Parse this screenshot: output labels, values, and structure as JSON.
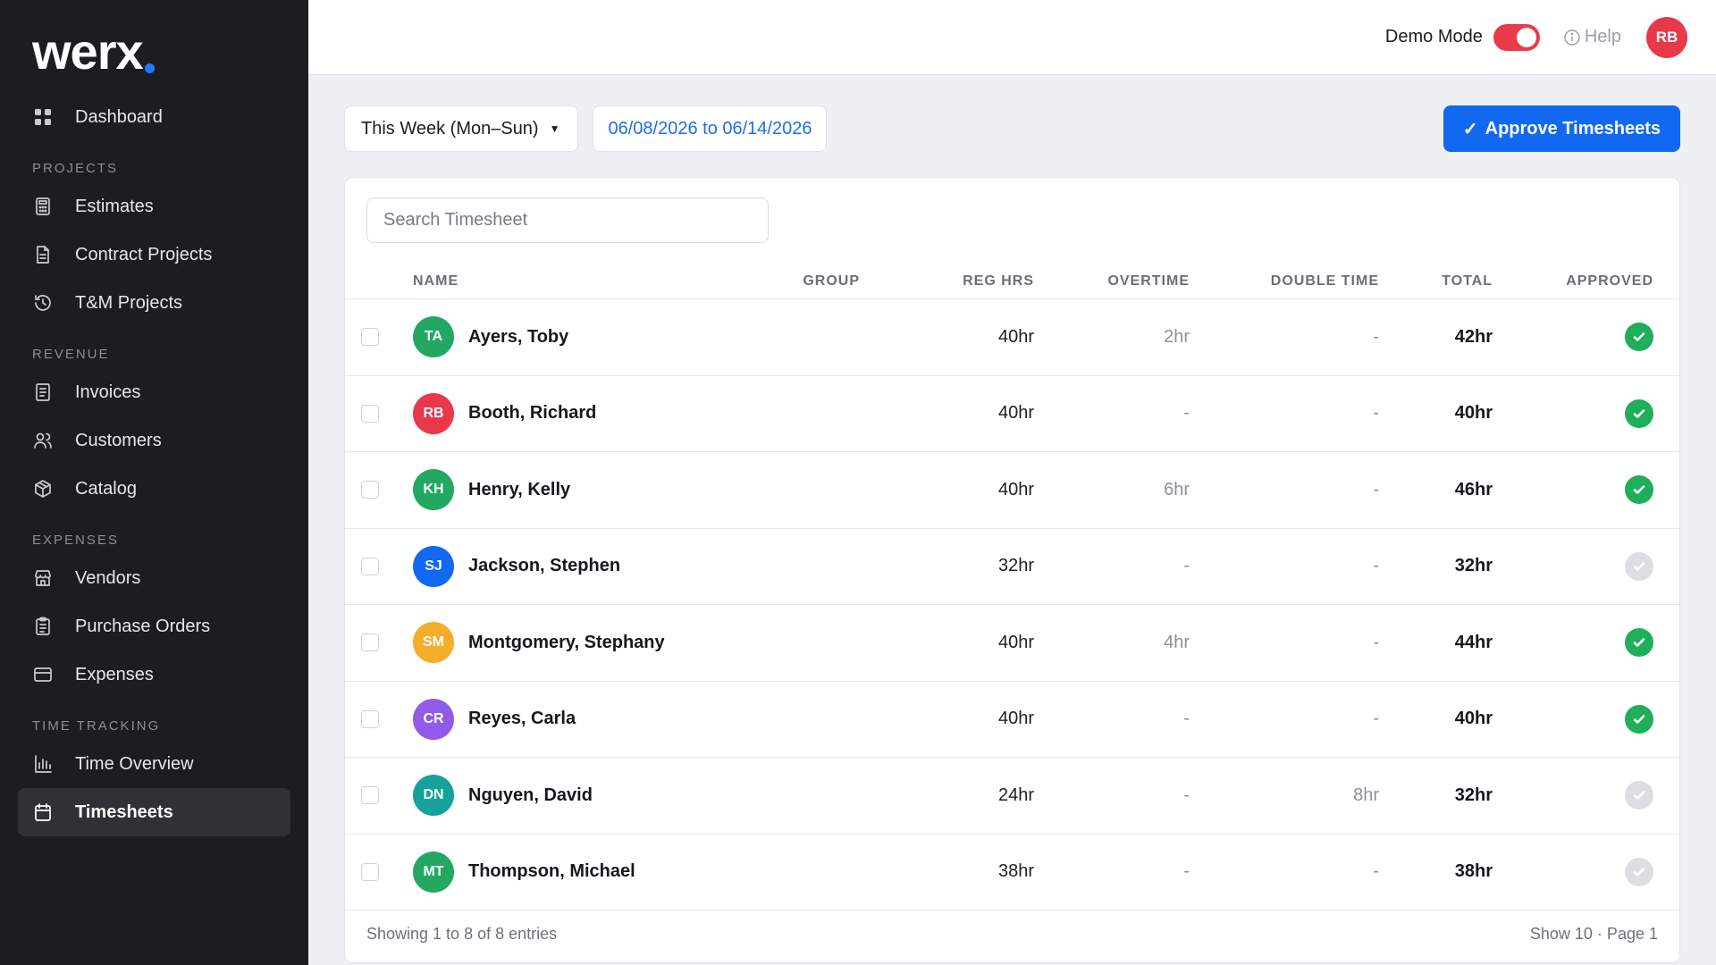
{
  "brand": {
    "name": "werx",
    "accent": "#1e7bff"
  },
  "sidebar": {
    "dashboard": {
      "label": "Dashboard",
      "icon": "dashboard-grid-icon"
    },
    "sections": [
      {
        "label": "PROJECTS",
        "items": [
          {
            "label": "Estimates",
            "icon": "calculator-icon"
          },
          {
            "label": "Contract Projects",
            "icon": "document-icon"
          },
          {
            "label": "T&M Projects",
            "icon": "history-icon"
          }
        ]
      },
      {
        "label": "REVENUE",
        "items": [
          {
            "label": "Invoices",
            "icon": "receipt-icon"
          },
          {
            "label": "Customers",
            "icon": "users-icon"
          },
          {
            "label": "Catalog",
            "icon": "box-icon"
          }
        ]
      },
      {
        "label": "EXPENSES",
        "items": [
          {
            "label": "Vendors",
            "icon": "store-icon"
          },
          {
            "label": "Purchase Orders",
            "icon": "clipboard-icon"
          },
          {
            "label": "Expenses",
            "icon": "credit-card-icon"
          }
        ]
      },
      {
        "label": "TIME TRACKING",
        "items": [
          {
            "label": "Time Overview",
            "icon": "bar-chart-icon"
          },
          {
            "label": "Timesheets",
            "icon": "calendar-icon",
            "active": true
          }
        ]
      }
    ]
  },
  "topbar": {
    "demo_mode_label": "Demo Mode",
    "demo_mode_on": true,
    "help_label": "Help",
    "user_initials": "RB",
    "user_color": "#e8384a"
  },
  "controls": {
    "week_select": "This Week (Mon–Sun)",
    "date_range": "06/08/2026 to 06/14/2026",
    "approve_label": "Approve Timesheets"
  },
  "search": {
    "placeholder": "Search Timesheet",
    "value": ""
  },
  "table": {
    "columns": {
      "name": "NAME",
      "group": "GROUP",
      "reg": "REG HRS",
      "overtime": "OVERTIME",
      "double": "DOUBLE TIME",
      "total": "TOTAL",
      "approved": "APPROVED"
    },
    "rows": [
      {
        "initials": "TA",
        "color": "#22a862",
        "name": "Ayers, Toby",
        "group": "",
        "reg": "40hr",
        "overtime": "2hr",
        "double": "-",
        "total": "42hr",
        "approved": true
      },
      {
        "initials": "RB",
        "color": "#e8384a",
        "name": "Booth, Richard",
        "group": "",
        "reg": "40hr",
        "overtime": "-",
        "double": "-",
        "total": "40hr",
        "approved": true
      },
      {
        "initials": "KH",
        "color": "#22a862",
        "name": "Henry, Kelly",
        "group": "",
        "reg": "40hr",
        "overtime": "6hr",
        "double": "-",
        "total": "46hr",
        "approved": true
      },
      {
        "initials": "SJ",
        "color": "#1169f2",
        "name": "Jackson, Stephen",
        "group": "",
        "reg": "32hr",
        "overtime": "-",
        "double": "-",
        "total": "32hr",
        "approved": false
      },
      {
        "initials": "SM",
        "color": "#f5ad2a",
        "name": "Montgomery, Stephany",
        "group": "",
        "reg": "40hr",
        "overtime": "4hr",
        "double": "-",
        "total": "44hr",
        "approved": true
      },
      {
        "initials": "CR",
        "color": "#8f5be8",
        "name": "Reyes, Carla",
        "group": "",
        "reg": "40hr",
        "overtime": "-",
        "double": "-",
        "total": "40hr",
        "approved": true
      },
      {
        "initials": "DN",
        "color": "#14a29a",
        "name": "Nguyen, David",
        "group": "",
        "reg": "24hr",
        "overtime": "-",
        "double": "8hr",
        "total": "32hr",
        "approved": false
      },
      {
        "initials": "MT",
        "color": "#22a862",
        "name": "Thompson, Michael",
        "group": "",
        "reg": "38hr",
        "overtime": "-",
        "double": "-",
        "total": "38hr",
        "approved": false
      }
    ]
  },
  "footer": {
    "showing": "Showing 1 to 8 of 8 entries",
    "pagination": "Show 10 · Page 1"
  }
}
